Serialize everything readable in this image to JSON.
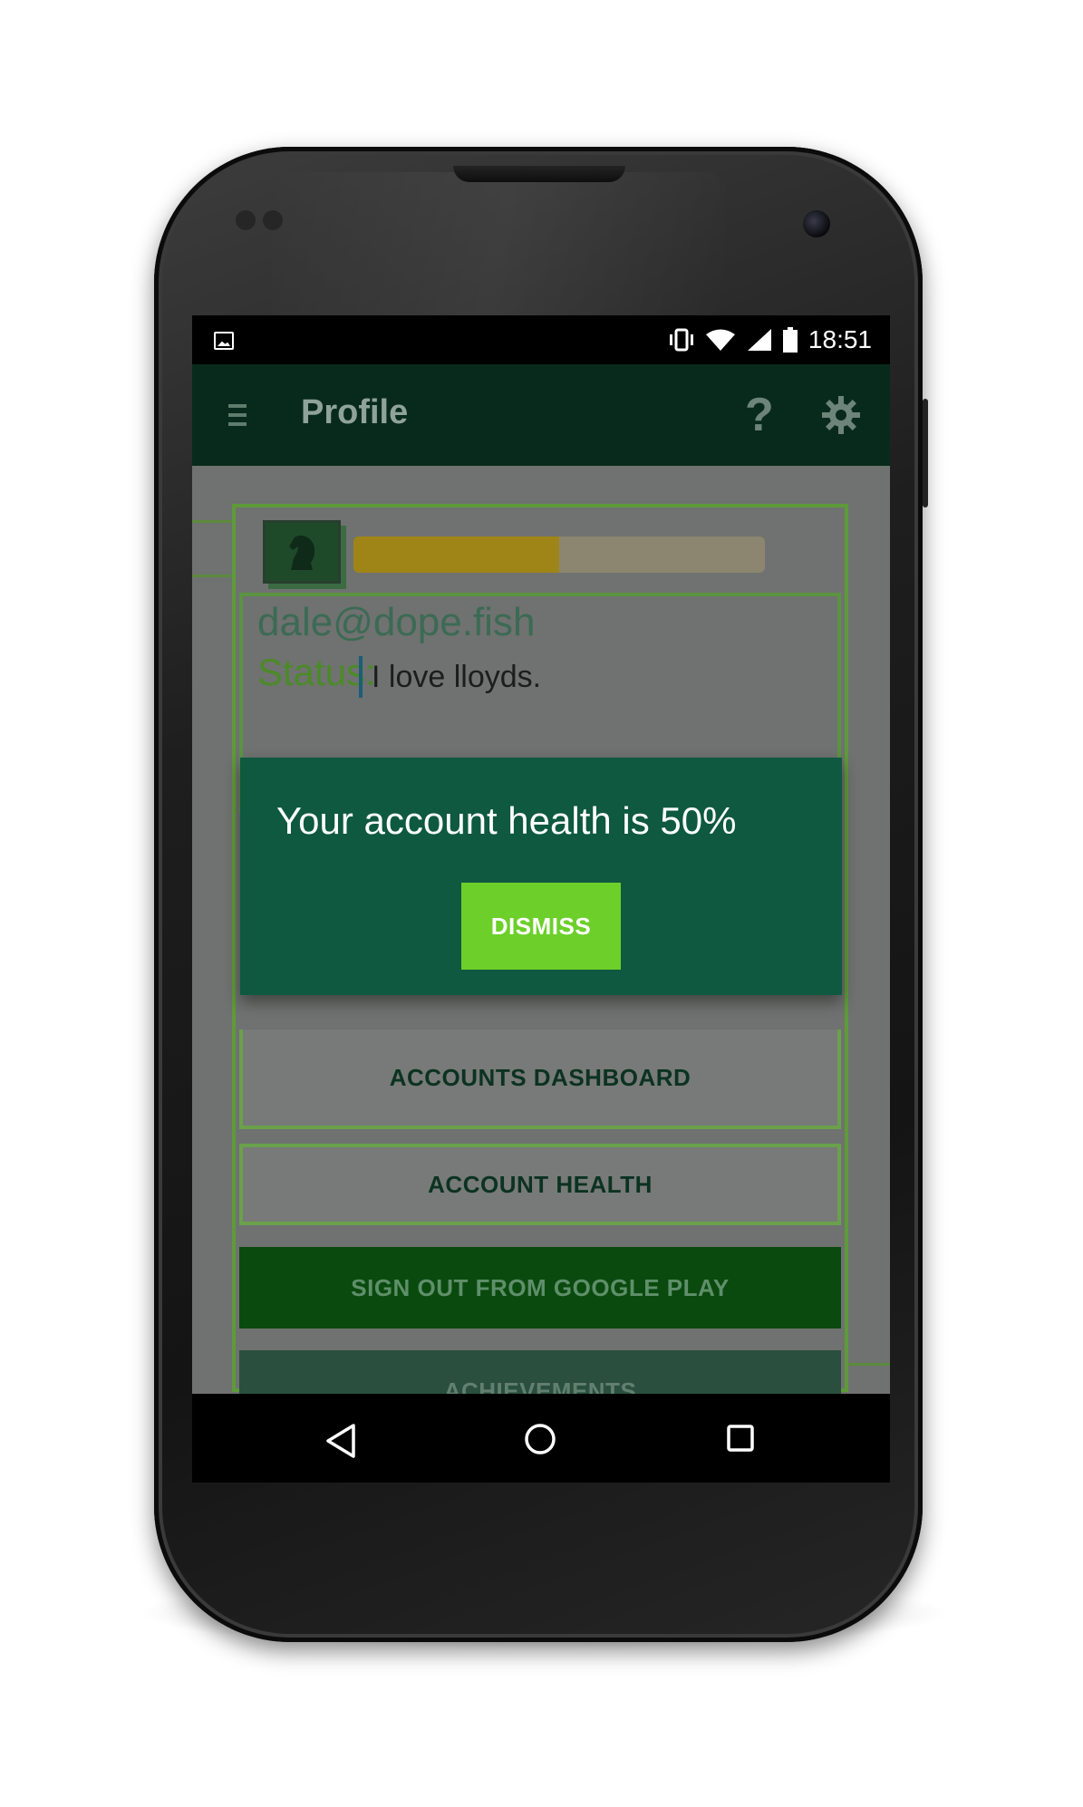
{
  "statusbar": {
    "time": "18:51",
    "icons": [
      "image-notification-icon",
      "vibrate-icon",
      "wifi-icon",
      "signal-icon",
      "battery-icon"
    ]
  },
  "appbar": {
    "title": "Profile",
    "help_label": "?",
    "icons": [
      "menu-icon",
      "help-icon",
      "gear-icon"
    ]
  },
  "profile": {
    "email": "dale@dope.fish",
    "status_label": "Status:",
    "status_value": "I love lloyds.",
    "progress_fraction": 0.5
  },
  "buttons": {
    "accounts_dashboard": "ACCOUNTS DASHBOARD",
    "account_health": "ACCOUNT HEALTH",
    "sign_out": "SIGN OUT FROM GOOGLE PLAY",
    "achievements": "ACHIEVEMENTS"
  },
  "dialog": {
    "message": "Your account health is 50%",
    "dismiss_label": "DISMISS"
  },
  "navbar": {
    "icons": [
      "back-icon",
      "home-icon",
      "recent-apps-icon"
    ]
  },
  "colors": {
    "appbar": "#082a1c",
    "dialog": "#0e5940",
    "dismiss": "#6ccf2a",
    "signout": "#0a4a0e",
    "progress_fill": "#9f8418"
  }
}
